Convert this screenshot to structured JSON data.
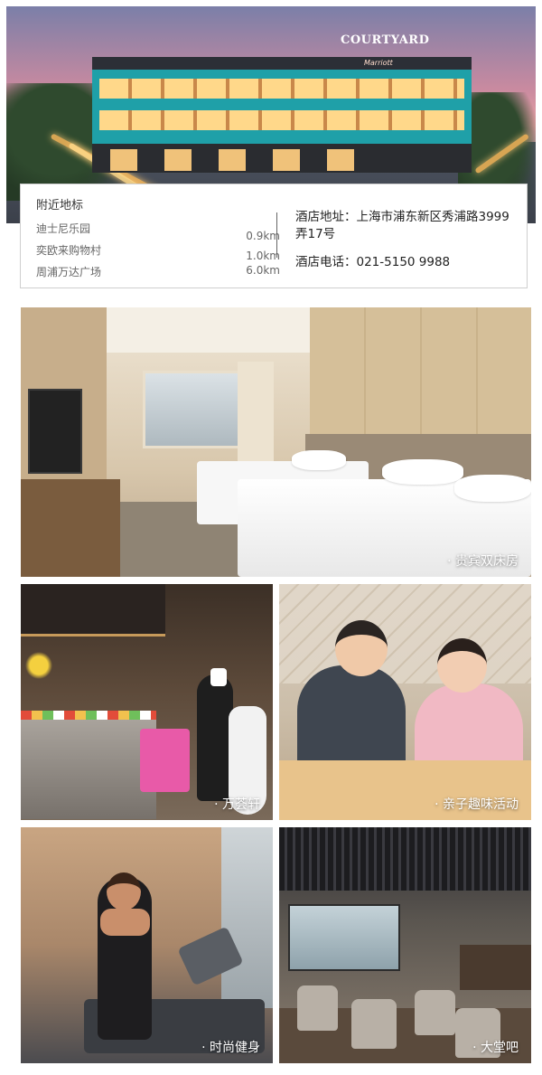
{
  "hero": {
    "brand": "COURTYARD",
    "brand_sub": "Marriott"
  },
  "info": {
    "title": "附近地标",
    "landmarks": [
      {
        "name": "迪士尼乐园",
        "distance": "0.9km"
      },
      {
        "name": "奕欧来购物村",
        "distance": "1.0km"
      },
      {
        "name": "周浦万达广场",
        "distance": "6.0km"
      }
    ],
    "address": "酒店地址：上海市浦东新区秀浦路3999弄17号",
    "phone": "酒店电话：021-5150 9988"
  },
  "photos": {
    "room_caption": "· 贵宾双床房",
    "buffet_caption": "· 万荟轩",
    "kids_caption": "· 亲子趣味活动",
    "gym_caption": "· 时尚健身",
    "lobby_caption": "· 大堂吧"
  }
}
